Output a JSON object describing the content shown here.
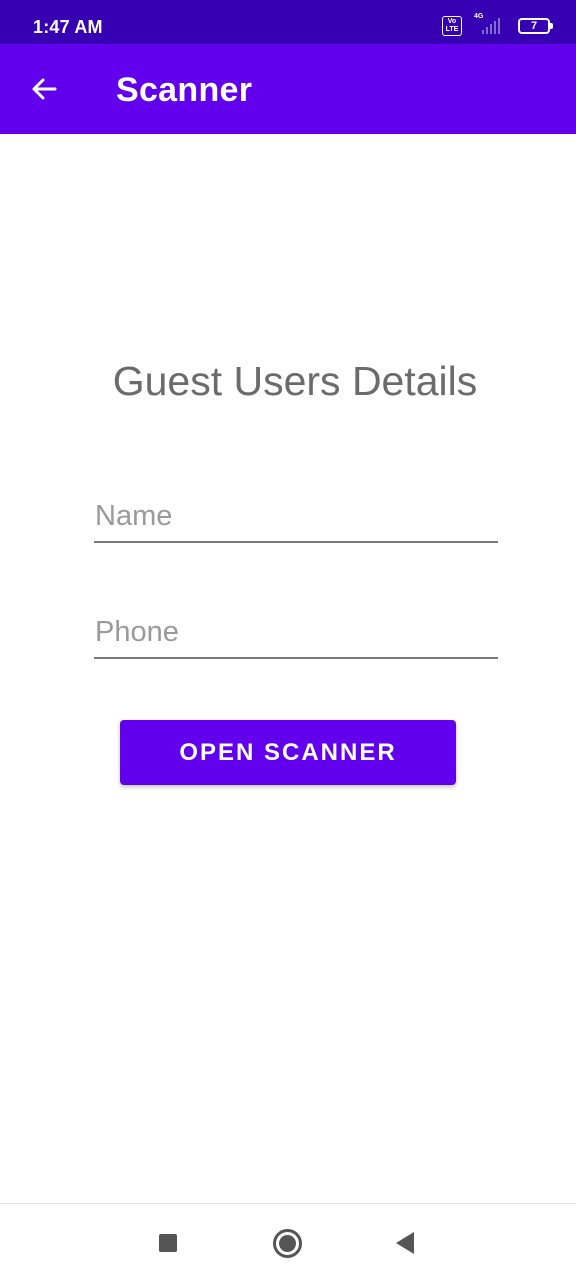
{
  "status_bar": {
    "time": "1:47 AM",
    "volte_line1": "Vo",
    "volte_line2": "LTE",
    "network": "4G",
    "battery_level": "7"
  },
  "app_bar": {
    "title": "Scanner",
    "back_icon": "arrow-back-icon"
  },
  "main": {
    "heading": "Guest Users Details",
    "name_field": {
      "placeholder": "Name",
      "value": ""
    },
    "phone_field": {
      "placeholder": "Phone",
      "value": ""
    },
    "open_scanner_label": "OPEN SCANNER"
  },
  "nav_bar": {
    "icons": [
      "square-recents-icon",
      "circle-home-icon",
      "triangle-back-icon"
    ]
  },
  "colors": {
    "status_bar": "#3700b3",
    "primary": "#6200ee",
    "heading_text": "#6b6b6b"
  }
}
